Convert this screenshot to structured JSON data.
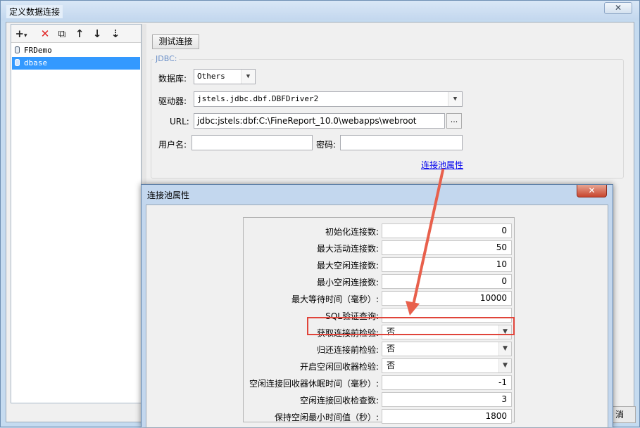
{
  "window": {
    "title": "定义数据连接",
    "close_glyph": "✕"
  },
  "toolbar": {
    "add": "+",
    "add_menu": "▾",
    "delete": "✕",
    "copy": "⧉",
    "move_up": "↑",
    "move_down": "↓",
    "sort": "⇣"
  },
  "connections": [
    {
      "label": "FRDemo",
      "selected": false
    },
    {
      "label": "dbase",
      "selected": true
    }
  ],
  "test_button": "测试连接",
  "jdbc": {
    "legend": "JDBC:",
    "database_label": "数据库:",
    "database_value": "Others",
    "driver_label": "驱动器:",
    "driver_value": "jstels.jdbc.dbf.DBFDriver2",
    "url_label": "URL:",
    "url_value": "jdbc:jstels:dbf:C:\\FineReport_10.0\\webapps\\webroot",
    "url_button": "...",
    "username_label": "用户名:",
    "username_value": "",
    "password_label": "密码:",
    "password_value": "",
    "pool_link": "连接池属性"
  },
  "bottom_button_partial": "消",
  "dialog": {
    "title": "连接池属性",
    "close_glyph": "✕",
    "properties": [
      {
        "label": "初始化连接数:",
        "value": "0",
        "kind": "number"
      },
      {
        "label": "最大活动连接数:",
        "value": "50",
        "kind": "number"
      },
      {
        "label": "最大空闲连接数:",
        "value": "10",
        "kind": "number"
      },
      {
        "label": "最小空闲连接数:",
        "value": "0",
        "kind": "number"
      },
      {
        "label": "最大等待时间（毫秒）:",
        "value": "10000",
        "kind": "number"
      },
      {
        "label": "SQL验证查询:",
        "value": "",
        "kind": "text"
      },
      {
        "label": "获取连接前检验:",
        "value": "否",
        "kind": "select"
      },
      {
        "label": "归还连接前检验:",
        "value": "否",
        "kind": "select"
      },
      {
        "label": "开启空闲回收器检验:",
        "value": "否",
        "kind": "select"
      },
      {
        "label": "空闲连接回收器休眠时间（毫秒）:",
        "value": "-1",
        "kind": "number"
      },
      {
        "label": "空闲连接回收检查数:",
        "value": "3",
        "kind": "number"
      },
      {
        "label": "保持空闲最小时间值（秒）:",
        "value": "1800",
        "kind": "number"
      }
    ]
  },
  "colors": {
    "highlight": "#e0443a",
    "annotation_arrow": "#e8604c",
    "selection": "#3399ff"
  }
}
